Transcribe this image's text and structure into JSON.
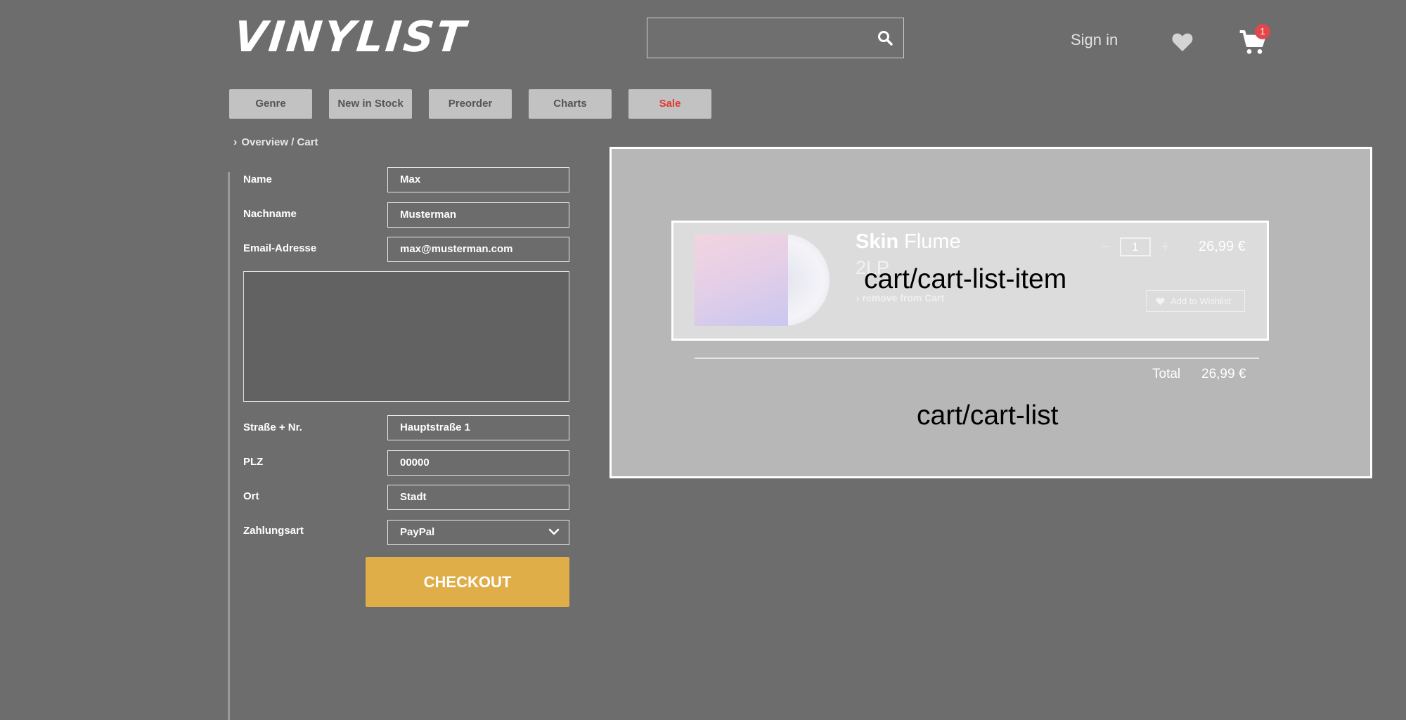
{
  "header": {
    "logo": "VINYLIST",
    "search_placeholder": "",
    "signin": "Sign in",
    "cart_count": "1"
  },
  "nav": {
    "tabs": [
      "Genre",
      "New in Stock",
      "Preorder",
      "Charts",
      "Sale"
    ]
  },
  "breadcrumb": "Overview / Cart",
  "form": {
    "name_label": "Name",
    "name_value": "Max",
    "nachname_label": "Nachname",
    "nachname_value": "Musterman",
    "email_label": "Email-Adresse",
    "email_value": "max@musterman.com",
    "strasse_label": "Straße + Nr.",
    "strasse_value": "Hauptstraße 1",
    "plz_label": "PLZ",
    "plz_value": "00000",
    "ort_label": "Ort",
    "ort_value": "Stadt",
    "zahlungsart_label": "Zahlungsart",
    "zahlungsart_value": "PayPal",
    "checkout_label": "CHECKOUT"
  },
  "cart": {
    "item": {
      "title": "Skin",
      "artist": "Flume",
      "format": "2LP",
      "remove_label": "remove from Cart",
      "qty_minus": "−",
      "qty": "1",
      "qty_plus": "+",
      "price": "26,99 €",
      "wishlist_label": "Add to Wishlist"
    },
    "total_label": "Total",
    "total_value": "26,99 €",
    "item_overlay_label": "cart/cart-list-item",
    "list_overlay_label": "cart/cart-list"
  },
  "colors": {
    "background": "#6d6d6d",
    "checkout": "#e0ae48",
    "sale": "#e03a30",
    "badge": "#e2474c"
  }
}
